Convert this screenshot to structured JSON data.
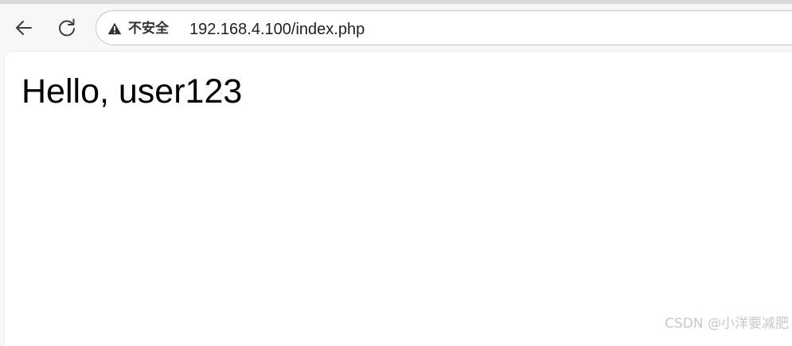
{
  "browser": {
    "security_label": "不安全",
    "url": "192.168.4.100/index.php",
    "back_icon": "arrow-left-icon",
    "reload_icon": "reload-icon",
    "security_icon": "warning-triangle-icon"
  },
  "page": {
    "greeting": "Hello, user123"
  },
  "watermark": {
    "text": "CSDN @小洋要减肥"
  },
  "colors": {
    "toolbar_bg": "#f7f7f7",
    "page_bg": "#ffffff",
    "omnibox_border": "#c7c7c7",
    "watermark": "#c8c8c8"
  }
}
